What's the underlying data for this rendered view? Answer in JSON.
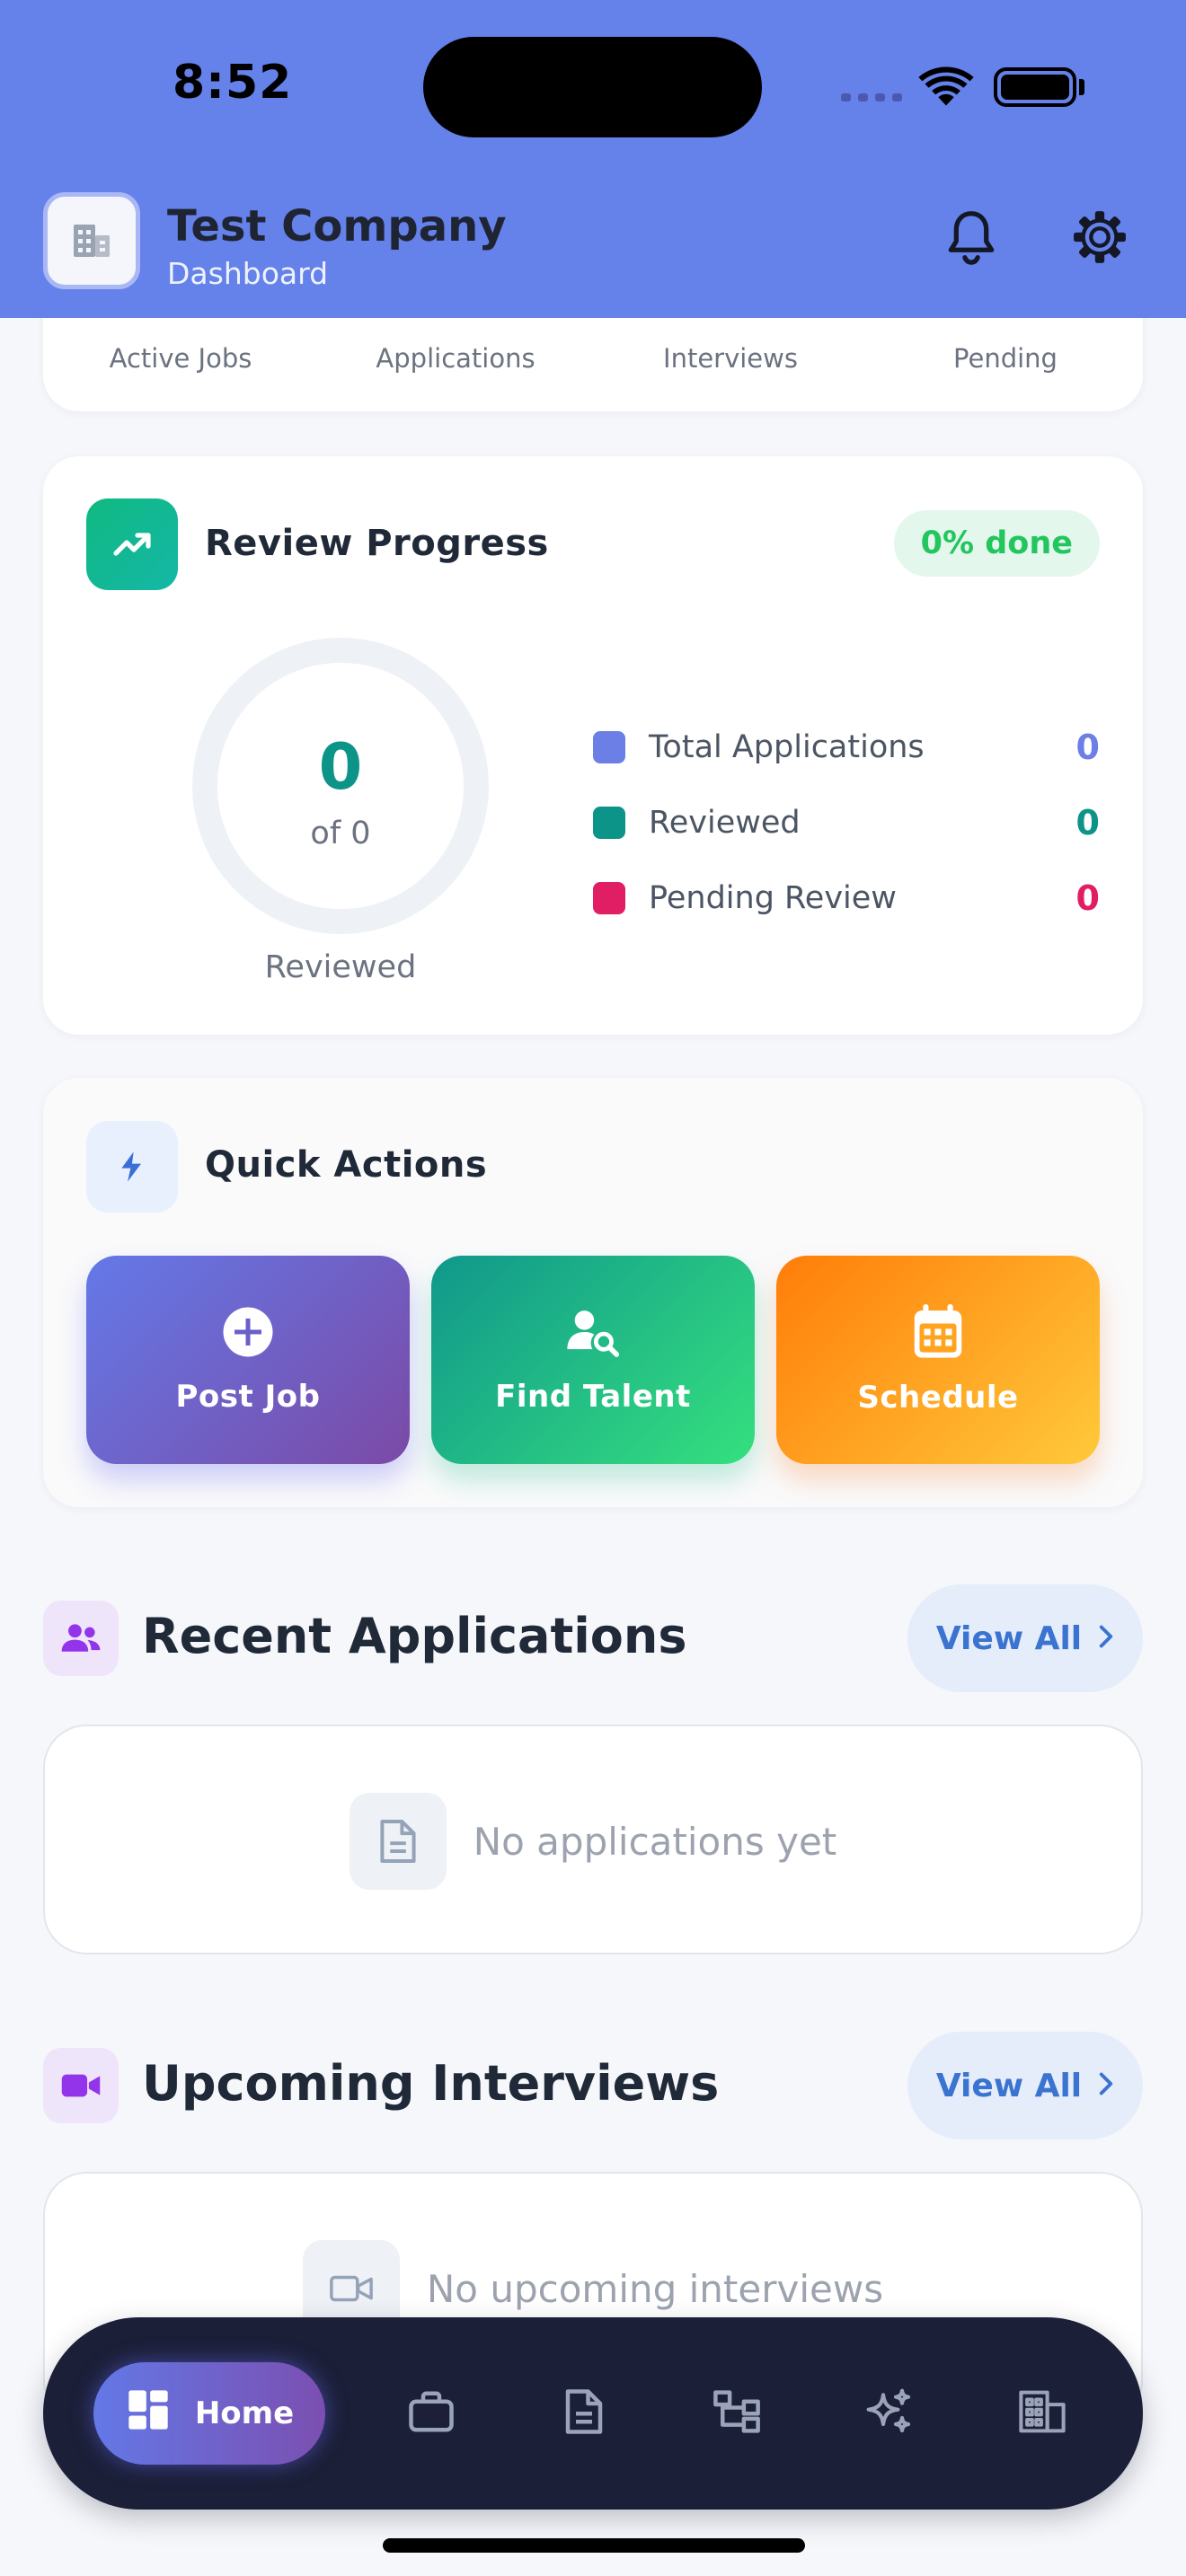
{
  "status_bar": {
    "time": "8:52"
  },
  "header": {
    "company_name": "Test Company",
    "subtitle": "Dashboard",
    "logo_icon": "building-icon",
    "notification_icon": "bell-icon",
    "settings_icon": "gear-icon"
  },
  "stats": {
    "labels": [
      "Active Jobs",
      "Applications",
      "Interviews",
      "Pending"
    ]
  },
  "review_progress": {
    "title": "Review Progress",
    "badge": "0% done",
    "progress_fraction": 0,
    "ring_value": "0",
    "ring_sub": "of 0",
    "ring_label": "Reviewed",
    "legend": [
      {
        "label": "Total Applications",
        "value": "0",
        "color": "#6b7fe6"
      },
      {
        "label": "Reviewed",
        "value": "0",
        "color": "#0d9488"
      },
      {
        "label": "Pending Review",
        "value": "0",
        "color": "#e11d63"
      }
    ]
  },
  "quick_actions": {
    "title": "Quick Actions",
    "buttons": [
      {
        "label": "Post Job",
        "icon": "plus-circle-icon"
      },
      {
        "label": "Find Talent",
        "icon": "user-search-icon"
      },
      {
        "label": "Schedule",
        "icon": "calendar-icon"
      }
    ]
  },
  "recent_applications": {
    "title": "Recent Applications",
    "view_all": "View All",
    "empty_text": "No applications yet"
  },
  "upcoming_interviews": {
    "title": "Upcoming Interviews",
    "view_all": "View All",
    "empty_text": "No upcoming interviews"
  },
  "bottom_nav": {
    "active_label": "Home",
    "items": [
      "home-icon",
      "briefcase-icon",
      "document-icon",
      "org-chart-icon",
      "sparkles-icon",
      "building-icon"
    ]
  },
  "colors": {
    "header_bg": "#6581ea",
    "accent_teal": "#0d9488",
    "accent_pink": "#e11d63",
    "accent_blue": "#6b7fe6",
    "nav_bg": "#1b1f37"
  }
}
